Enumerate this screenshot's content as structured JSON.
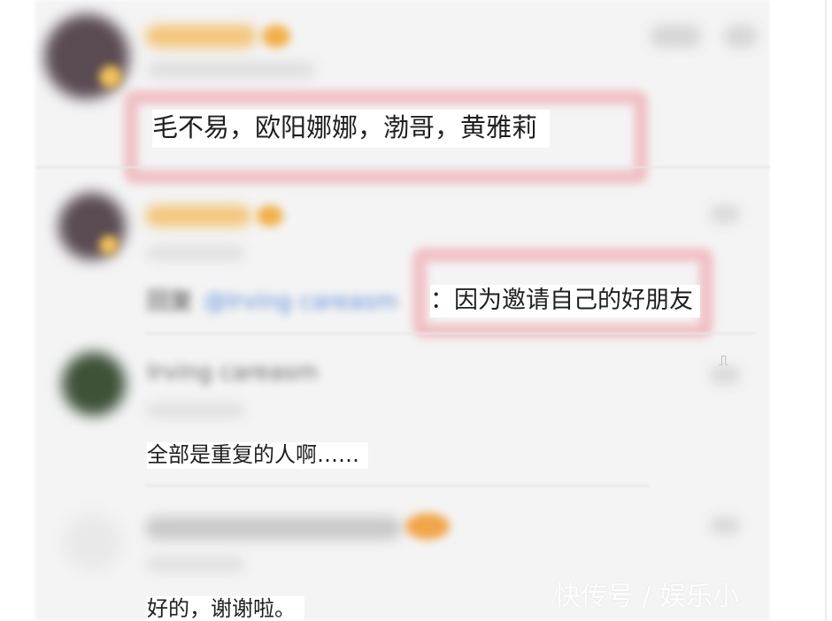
{
  "comments": [
    {
      "text": "毛不易，欧阳娜娜，渤哥，黄雅莉"
    },
    {
      "text_prefix": "回复",
      "mention": "@Irving careasm",
      "text": "：因为邀请自己的好朋友"
    },
    {
      "author": "Irving careasm",
      "text": "全部是重复的人啊……"
    },
    {
      "text": "好的，谢谢啦。"
    }
  ],
  "icons": {
    "like": "like-icon",
    "more": "more-icon",
    "reply": "reply-icon"
  },
  "watermark": "快传号 / 娱乐小",
  "colors": {
    "highlight": "#f0b7bd",
    "badge": "#f3b44f",
    "mention": "#5b8fd6",
    "panel": "#f4f4f5"
  }
}
